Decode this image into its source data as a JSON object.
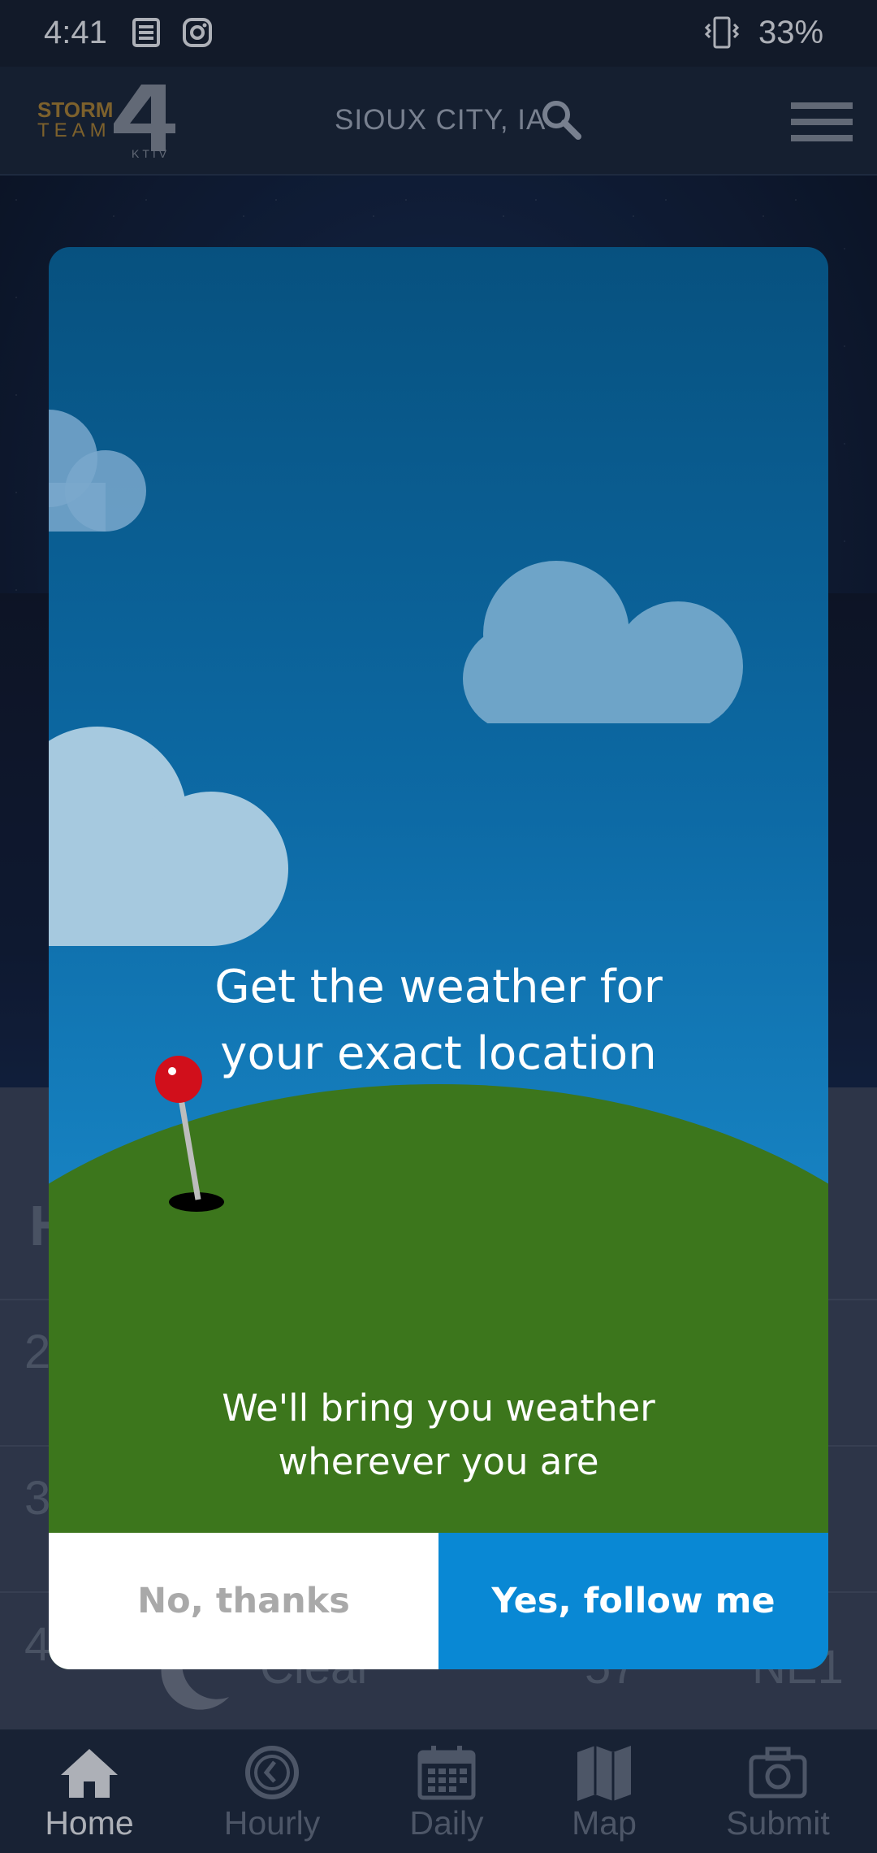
{
  "status_bar": {
    "time": "4:41",
    "battery": "33%",
    "icons": [
      "news-icon",
      "instagram-icon",
      "vibrate-icon"
    ]
  },
  "header": {
    "logo_lines": [
      "STORM",
      "TEAM",
      "KTIV"
    ],
    "location": "SIOUX CITY, IA",
    "icons": [
      "search-icon",
      "menu-icon"
    ]
  },
  "background_list": {
    "row_labels": [
      "H",
      "2",
      "3",
      "4"
    ],
    "condition": "Clear",
    "temp": "57",
    "wind": "NE1"
  },
  "dialog": {
    "title_line1": "Get the weather for",
    "title_line2": "your exact location",
    "subtitle_line1": "We'll bring you weather",
    "subtitle_line2": "wherever you are",
    "decline_label": "No, thanks",
    "accept_label": "Yes, follow me"
  },
  "bottom_nav": {
    "items": [
      {
        "label": "Home",
        "icon": "home-icon"
      },
      {
        "label": "Hourly",
        "icon": "clock-icon"
      },
      {
        "label": "Daily",
        "icon": "calendar-icon"
      },
      {
        "label": "Map",
        "icon": "map-icon"
      },
      {
        "label": "Submit",
        "icon": "camera-icon"
      }
    ]
  },
  "colors": {
    "accent": "#0988d4",
    "grass": "#3c761c",
    "sky_top": "#07517f"
  }
}
